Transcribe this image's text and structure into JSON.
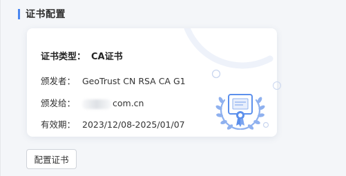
{
  "section": {
    "title": "证书配置"
  },
  "certificate": {
    "type_label": "证书类型：",
    "type_value": "CA证书",
    "issuer_label": "颁发者：",
    "issuer_value": "GeoTrust CN RSA CA G1",
    "issued_to_label": "颁发给：",
    "issued_to_value": "com.cn",
    "validity_label": "有效期：",
    "validity_value": "2023/12/08-2025/01/07"
  },
  "actions": {
    "configure_label": "配置证书"
  },
  "icons": {
    "badge": "certificate-badge-icon"
  },
  "colors": {
    "accent": "#4a86f0",
    "badge": "#5b8fec",
    "card_bg": "#ffffff",
    "page_bg": "#f4f6f9"
  }
}
